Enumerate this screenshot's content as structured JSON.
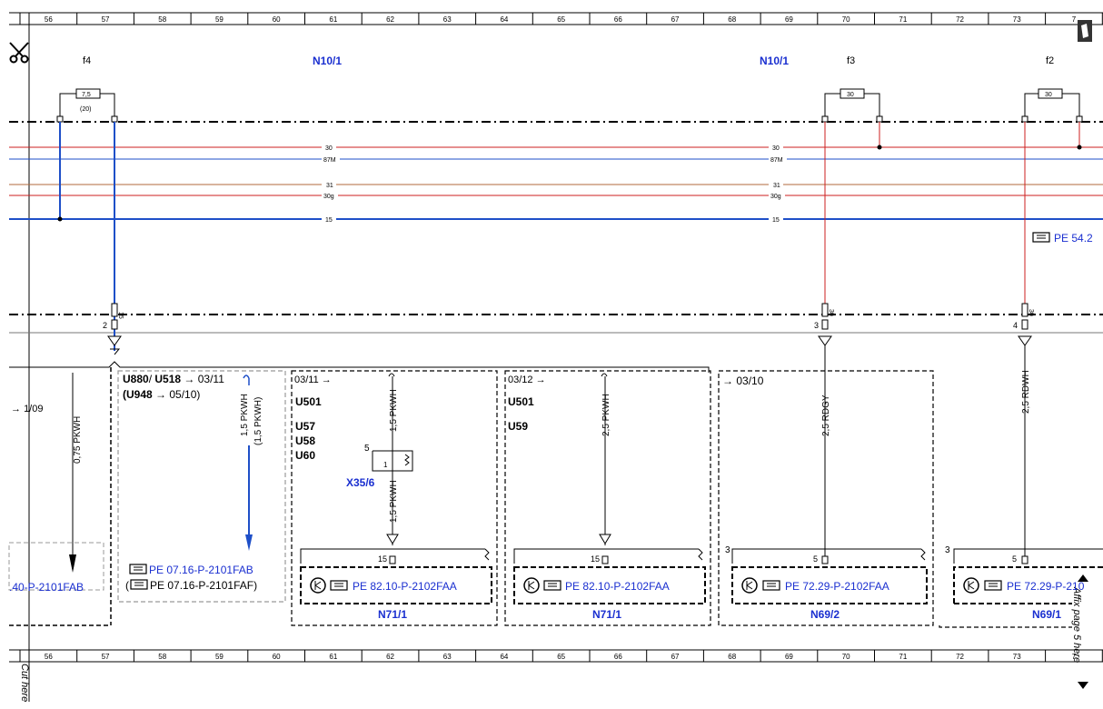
{
  "ruler": {
    "numbers": [
      "56",
      "57",
      "58",
      "59",
      "60",
      "61",
      "62",
      "63",
      "64",
      "65",
      "66",
      "67",
      "68",
      "69",
      "70",
      "71",
      "72",
      "73",
      "7"
    ]
  },
  "edge": {
    "cut_here": "Cut here",
    "affix_page": "Affix page 5 here"
  },
  "top": {
    "fuse_f4": {
      "label": "f4",
      "rating": "7,5",
      "note": "(20)"
    },
    "fuse_f3": {
      "label": "f3",
      "rating": "30"
    },
    "fuse_f2": {
      "label": "f2",
      "rating": "30"
    },
    "module_left": "N10/1",
    "module_right": "N10/1"
  },
  "bus": {
    "left": [
      "30",
      "87M",
      "31",
      "30g",
      "15"
    ],
    "right": [
      "30",
      "87M",
      "31",
      "30g",
      "15"
    ]
  },
  "ref_pe_542": "PE 54.2",
  "connectors": {
    "c2": {
      "pin": "15",
      "num": "2"
    },
    "c3": {
      "pin": "30",
      "num": "3"
    },
    "c4": {
      "pin": "30",
      "num": "4"
    }
  },
  "sec_leftmost": {
    "arrow_ref": "1/09",
    "wire": "0,75 PKWH",
    "ref": ".40-P-2101FAB"
  },
  "sec_u880": {
    "line1_a": "U880",
    "line1_sep": "/",
    "line1_b": "U518",
    "line1_ref": "03/11",
    "line2_a": "(U948",
    "line2_ref": "05/10)",
    "wire1": "1,5 PKWH",
    "wire2": "(1,5 PKWH)",
    "ref1": "PE 07.16-P-2101FAB",
    "ref2_open": "(",
    "ref2": "PE 07.16-P-2101FAF)"
  },
  "sec_n711a": {
    "ref": "03/11",
    "codes": [
      "U501",
      "U57",
      "U58",
      "U60"
    ],
    "wire_top": "1,5 PKWH",
    "wire_bottom": "1,5 PKWH",
    "conn_pin_5": "5",
    "conn_pin_1": "1",
    "conn_label": "X35/6",
    "pin": "15",
    "pe_ref": "PE 82.10-P-2102FAA",
    "name": "N71/1"
  },
  "sec_n711b": {
    "ref": "03/12",
    "codes": [
      "U501",
      "U59"
    ],
    "wire": "2,5 PKWH",
    "pin": "15",
    "pe_ref": "PE 82.10-P-2102FAA",
    "name": "N71/1"
  },
  "sec_n692": {
    "ref": "03/10",
    "wire": "2,5 RDGY",
    "pin": "5",
    "num": "3",
    "pe_ref": "PE 72.29-P-2102FAA",
    "name": "N69/2"
  },
  "sec_n691": {
    "wire": "2,5 RDWH",
    "pin": "5",
    "num": "3",
    "pe_ref": "PE 72.29-P-210",
    "name": "N69/1"
  },
  "colors": {
    "blue_text": "#1a2fd0",
    "red_wire": "#cc1f1f",
    "blue_wire": "#1e4fc8",
    "brown_wire": "#b06a3c"
  }
}
